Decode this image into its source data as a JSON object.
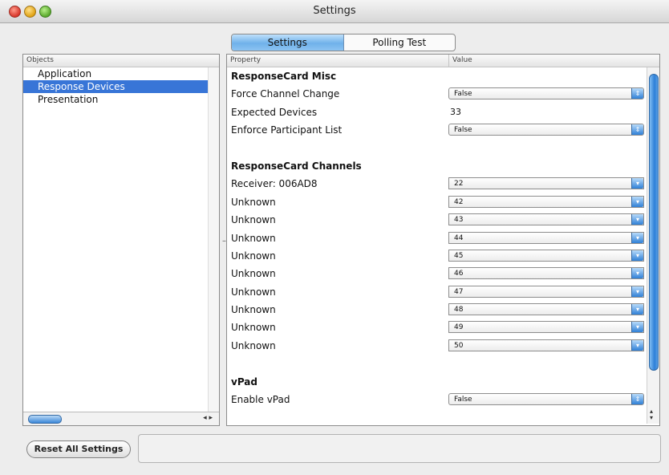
{
  "window": {
    "title": "Settings"
  },
  "tabs": [
    {
      "label": "Settings",
      "active": true
    },
    {
      "label": "Polling Test",
      "active": false
    }
  ],
  "objects_panel": {
    "header": "Objects",
    "items": [
      {
        "label": "Application",
        "selected": false
      },
      {
        "label": "Response Devices",
        "selected": true
      },
      {
        "label": "Presentation",
        "selected": false
      }
    ]
  },
  "properties_panel": {
    "headers": {
      "property": "Property",
      "value": "Value"
    },
    "rows": [
      {
        "kind": "section",
        "label": "ResponseCard Misc"
      },
      {
        "kind": "select",
        "label": "Force Channel Change",
        "value": "False"
      },
      {
        "kind": "text",
        "label": "Expected Devices",
        "value": "33"
      },
      {
        "kind": "select",
        "label": "Enforce Participant List",
        "value": "False"
      },
      {
        "kind": "blank"
      },
      {
        "kind": "section",
        "label": "ResponseCard Channels"
      },
      {
        "kind": "combo",
        "label": "Receiver: 006AD8",
        "value": "22"
      },
      {
        "kind": "combo",
        "label": "Unknown",
        "value": "42"
      },
      {
        "kind": "combo",
        "label": "Unknown",
        "value": "43"
      },
      {
        "kind": "combo",
        "label": "Unknown",
        "value": "44"
      },
      {
        "kind": "combo",
        "label": "Unknown",
        "value": "45"
      },
      {
        "kind": "combo",
        "label": "Unknown",
        "value": "46"
      },
      {
        "kind": "combo",
        "label": "Unknown",
        "value": "47"
      },
      {
        "kind": "combo",
        "label": "Unknown",
        "value": "48"
      },
      {
        "kind": "combo",
        "label": "Unknown",
        "value": "49"
      },
      {
        "kind": "combo",
        "label": "Unknown",
        "value": "50"
      },
      {
        "kind": "blank"
      },
      {
        "kind": "section",
        "label": "vPad"
      },
      {
        "kind": "select",
        "label": "Enable vPad",
        "value": "False"
      }
    ]
  },
  "footer": {
    "reset_label": "Reset All Settings"
  },
  "colors": {
    "selection": "#3875d7",
    "accent_blue": "#2f7fd6"
  }
}
